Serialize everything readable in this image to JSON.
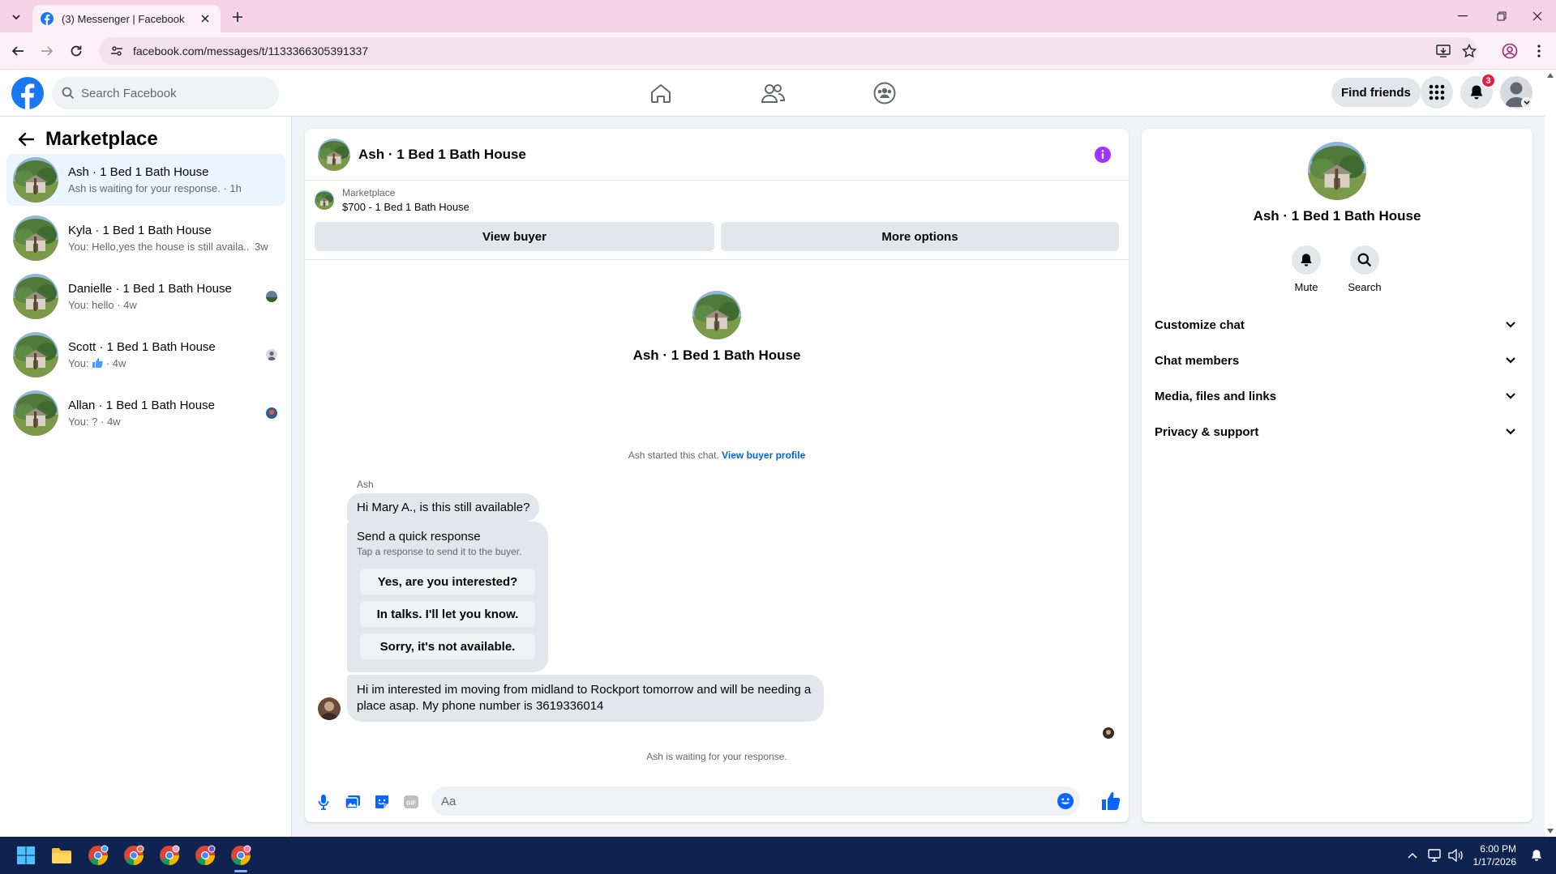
{
  "browser": {
    "tab_title": "(3) Messenger | Facebook",
    "url": "facebook.com/messages/t/1133366305391337"
  },
  "fb": {
    "search_placeholder": "Search Facebook",
    "find_friends": "Find friends",
    "notification_count": "3",
    "brand_color": "#1877f2"
  },
  "sidebar": {
    "title": "Marketplace",
    "conversations": [
      {
        "name": "Ash · 1 Bed 1 Bath House",
        "preview": "Ash is waiting for your response. · 1h",
        "active": true
      },
      {
        "name": "Kyla · 1 Bed 1 Bath House",
        "preview": "You: Hello,yes the house is still availa...",
        "time": "3w"
      },
      {
        "name": "Danielle · 1 Bed 1 Bath House",
        "preview": "You: hello · 4w"
      },
      {
        "name": "Scott · 1 Bed 1 Bath House",
        "preview_prefix": "You:",
        "preview_suffix": "· 4w"
      },
      {
        "name": "Allan · 1 Bed 1 Bath House",
        "preview": "You: ? · 4w"
      }
    ]
  },
  "chat": {
    "title": "Ash · 1 Bed 1 Bath House",
    "listing_source": "Marketplace",
    "listing_price": "$700 - 1 Bed 1 Bath House",
    "view_buyer": "View buyer",
    "more_options": "More options",
    "intro_name": "Ash · 1 Bed 1 Bath House",
    "started_text": "Ash started this chat.",
    "view_buyer_profile": "View buyer profile",
    "sender": "Ash",
    "message1": "Hi Mary A., is this still available?",
    "quick_title": "Send a quick response",
    "quick_subtitle": "Tap a response to send it to the buyer.",
    "quick_replies": [
      "Yes, are you interested?",
      "In talks. I'll let you know.",
      "Sorry, it's not available."
    ],
    "message2": "Hi im interested im moving from midland to Rockport tomorrow and will be needing a place asap. My phone number is 3619336014",
    "waiting": "Ash is waiting for your response.",
    "input_placeholder": "Aa"
  },
  "info": {
    "name": "Ash · 1 Bed 1 Bath House",
    "actions": [
      "Mute",
      "Search"
    ],
    "sections": [
      "Customize chat",
      "Chat members",
      "Media, files and links",
      "Privacy & support"
    ]
  },
  "taskbar": {
    "time": "6:00 PM",
    "date": "1/17/2026"
  }
}
